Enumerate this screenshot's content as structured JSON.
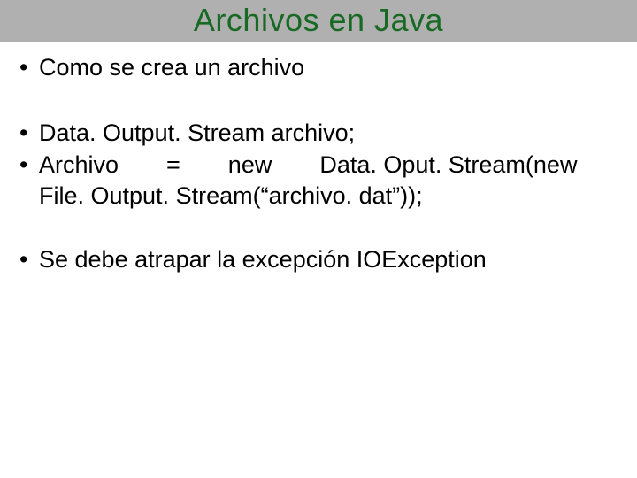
{
  "title": "Archivos en Java",
  "bullets": {
    "b1": "Como se crea un archivo",
    "b2": "Data. Output. Stream archivo;",
    "b3a": "Archivo  =  new  Data. Oput. Stream(new",
    "b3b": "File. Output. Stream(“archivo. dat”));",
    "b4": "Se debe atrapar la excepción IOException"
  }
}
